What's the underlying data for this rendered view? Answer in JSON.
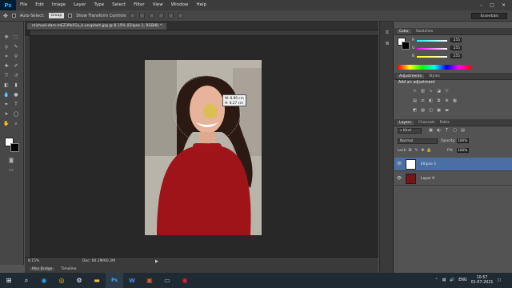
{
  "app": {
    "logo": "Ps"
  },
  "menu": [
    "File",
    "Edit",
    "Image",
    "Layer",
    "Type",
    "Select",
    "Filter",
    "View",
    "Window",
    "Help"
  ],
  "window_controls": [
    "–",
    "□",
    "✕"
  ],
  "options_bar": {
    "auto_select_label": "Auto-Select:",
    "auto_select_target": "Group",
    "show_transform_label": "Show Transform Controls",
    "workspace": "Essentials"
  },
  "document": {
    "tab_title": "michael-dam-mEZ3PoFGs_k-unsplash.jpg @ 8.15% (Ellipse 1, RGB/8) *",
    "zoom": "8.15%",
    "doc_info": "Doc: 60.2M/60.2M",
    "measure_w": "W: 8.89 cm",
    "measure_h": "H: 8.27 cm"
  },
  "bottom_tabs": [
    "Mini Bridge",
    "Timeline"
  ],
  "color_panel": {
    "tabs": [
      "Color",
      "Swatches"
    ],
    "channels": [
      {
        "label": "R",
        "value": "255"
      },
      {
        "label": "G",
        "value": "255"
      },
      {
        "label": "B",
        "value": "255"
      }
    ]
  },
  "adjustments_panel": {
    "tabs": [
      "Adjustments",
      "Styles"
    ],
    "heading": "Add an adjustment"
  },
  "layers_panel": {
    "tabs": [
      "Layers",
      "Channels",
      "Paths"
    ],
    "kind_label": "Kind",
    "blend_mode": "Normal",
    "opacity_label": "Opacity:",
    "opacity_value": "100%",
    "lock_label": "Lock:",
    "fill_label": "Fill:",
    "fill_value": "100%",
    "layers": [
      {
        "name": "Ellipse 1",
        "selected": true
      },
      {
        "name": "Layer 0",
        "selected": false
      }
    ]
  },
  "taskbar": {
    "language": "ENG",
    "time": "10:57",
    "date": "01-07-2021"
  },
  "colors": {
    "accent_red": "#b5121b",
    "selection_blue": "#4a6fa5",
    "ps_blue": "#31a8ff"
  }
}
